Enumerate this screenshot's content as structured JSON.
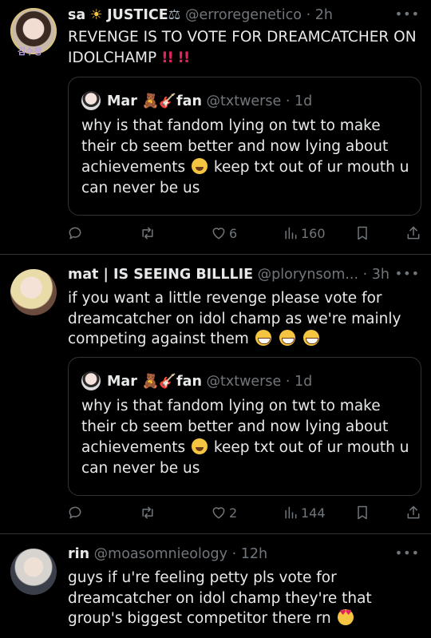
{
  "tweets": [
    {
      "name": "sa",
      "name_suffix": "JUSTICE",
      "handle": "@erroregenetico",
      "time": "· 2h",
      "text": "REVENGE IS TO VOTE FOR DREAMCATCHER ON IDOLCHAMP",
      "quote": {
        "name": "Mar",
        "name_suffix": "fan",
        "handle": "@txtwerse",
        "time": "· 1d",
        "text_a": "why is that fandom lying on twt to make their cb seem better and now lying about achievements",
        "text_b": "keep txt out of ur mouth u can never be us"
      },
      "likes": "6",
      "views": "160"
    },
    {
      "name": "mat | IS SEEING BILLLIE",
      "handle": "@plorynsom...",
      "time": "· 3h",
      "text": "if you want a little revenge please vote for dreamcatcher on idol champ as we're mainly competing against them",
      "quote": {
        "name": "Mar",
        "name_suffix": "fan",
        "handle": "@txtwerse",
        "time": "· 1d",
        "text_a": "why is that fandom lying on twt to make their cb seem better and now lying about achievements",
        "text_b": "keep txt out of ur mouth u can never be us"
      },
      "likes": "2",
      "views": "144"
    },
    {
      "name": "rin",
      "handle": "@moasomnieology",
      "time": "· 12h",
      "text": "guys if u're feeling petty pls vote for dreamcatcher on idol champ they're that group's biggest competitor there rn"
    }
  ],
  "avatar_tag": "김수정",
  "icons": [
    "reply-icon",
    "retweet-icon",
    "like-icon",
    "views-icon",
    "bookmark-icon",
    "share-icon",
    "more-icon"
  ],
  "colors": {
    "background": "#000000",
    "text": "#e7e9ea",
    "muted": "#71767b",
    "border": "#2f3336"
  }
}
